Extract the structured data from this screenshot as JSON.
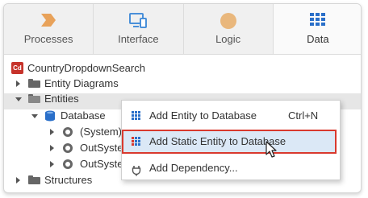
{
  "tabs": [
    {
      "label": "Processes",
      "icon": "processes-chevron-icon",
      "color": "#e8a25a"
    },
    {
      "label": "Interface",
      "icon": "monitor-icon",
      "color": "#4a90d9"
    },
    {
      "label": "Logic",
      "icon": "logic-circle-icon",
      "color": "#e9b77c"
    },
    {
      "label": "Data",
      "icon": "data-grid-icon",
      "color": "#2a6fc9"
    }
  ],
  "tree": {
    "app": {
      "badge": "Cd",
      "label": "CountryDropdownSearch"
    },
    "entity_diagrams": "Entity Diagrams",
    "entities": "Entities",
    "database": "Database",
    "system": "(System)",
    "outsystems_1": "OutSystem",
    "outsystems_2": "OutSystem",
    "structures": "Structures"
  },
  "menu": {
    "items": [
      {
        "label": "Add Entity to Database",
        "shortcut": "Ctrl+N"
      },
      {
        "label": "Add Static Entity to Database",
        "shortcut": ""
      },
      {
        "label": "Add Dependency...",
        "shortcut": ""
      }
    ]
  },
  "colors": {
    "highlight_border": "#d9392e",
    "highlight_fill": "#dbe8f6",
    "app_badge": "#c6332b"
  }
}
